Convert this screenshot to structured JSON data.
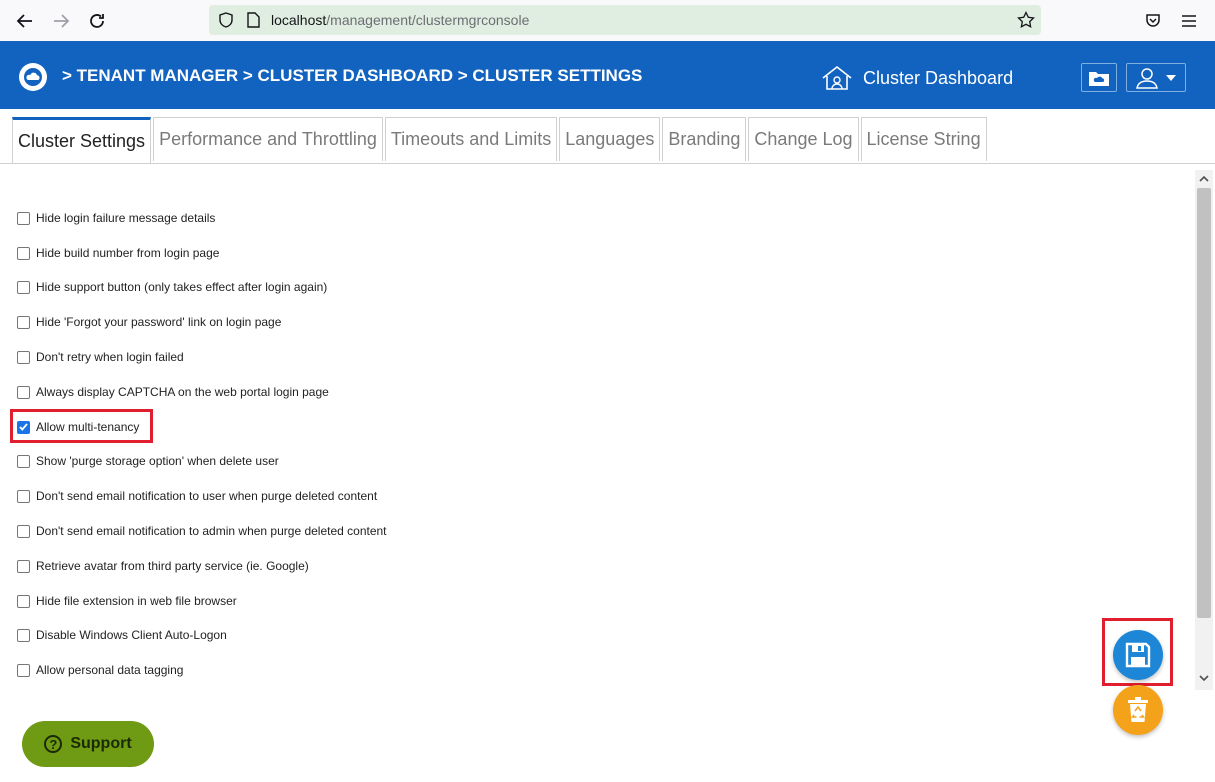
{
  "browser": {
    "url_host": "localhost",
    "url_path": "/management/clustermgrconsole"
  },
  "header": {
    "breadcrumb": "> TENANT MANAGER > CLUSTER DASHBOARD > CLUSTER SETTINGS",
    "dashboard_label": "Cluster Dashboard"
  },
  "tabs": [
    {
      "label": "Cluster Settings",
      "active": true
    },
    {
      "label": "Performance and Throttling"
    },
    {
      "label": "Timeouts and Limits"
    },
    {
      "label": "Languages"
    },
    {
      "label": "Branding"
    },
    {
      "label": "Change Log"
    },
    {
      "label": "License String"
    }
  ],
  "settings": [
    {
      "label": "Hide login failure message details",
      "checked": false
    },
    {
      "label": "Hide build number from login page",
      "checked": false
    },
    {
      "label": "Hide support button (only takes effect after login again)",
      "checked": false
    },
    {
      "label": "Hide 'Forgot your password' link on login page",
      "checked": false
    },
    {
      "label": "Don't retry when login failed",
      "checked": false
    },
    {
      "label": "Always display CAPTCHA on the web portal login page",
      "checked": false
    },
    {
      "label": "Allow multi-tenancy",
      "checked": true
    },
    {
      "label": "Show 'purge storage option' when delete user",
      "checked": false
    },
    {
      "label": "Don't send email notification to user when purge deleted content",
      "checked": false
    },
    {
      "label": "Don't send email notification to admin when purge deleted content",
      "checked": false
    },
    {
      "label": "Retrieve avatar from third party service (ie. Google)",
      "checked": false
    },
    {
      "label": "Hide file extension in web file browser",
      "checked": false
    },
    {
      "label": "Disable Windows Client Auto-Logon",
      "checked": false
    },
    {
      "label": "Allow personal data tagging",
      "checked": false
    }
  ],
  "support": {
    "label": "Support",
    "icon_glyph": "?"
  },
  "colors": {
    "header_bg": "#1263c0",
    "save_button": "#1e86d6",
    "recycle_button": "#f5a21b",
    "support_button": "#6f9a13",
    "highlight": "#e01e2e"
  }
}
